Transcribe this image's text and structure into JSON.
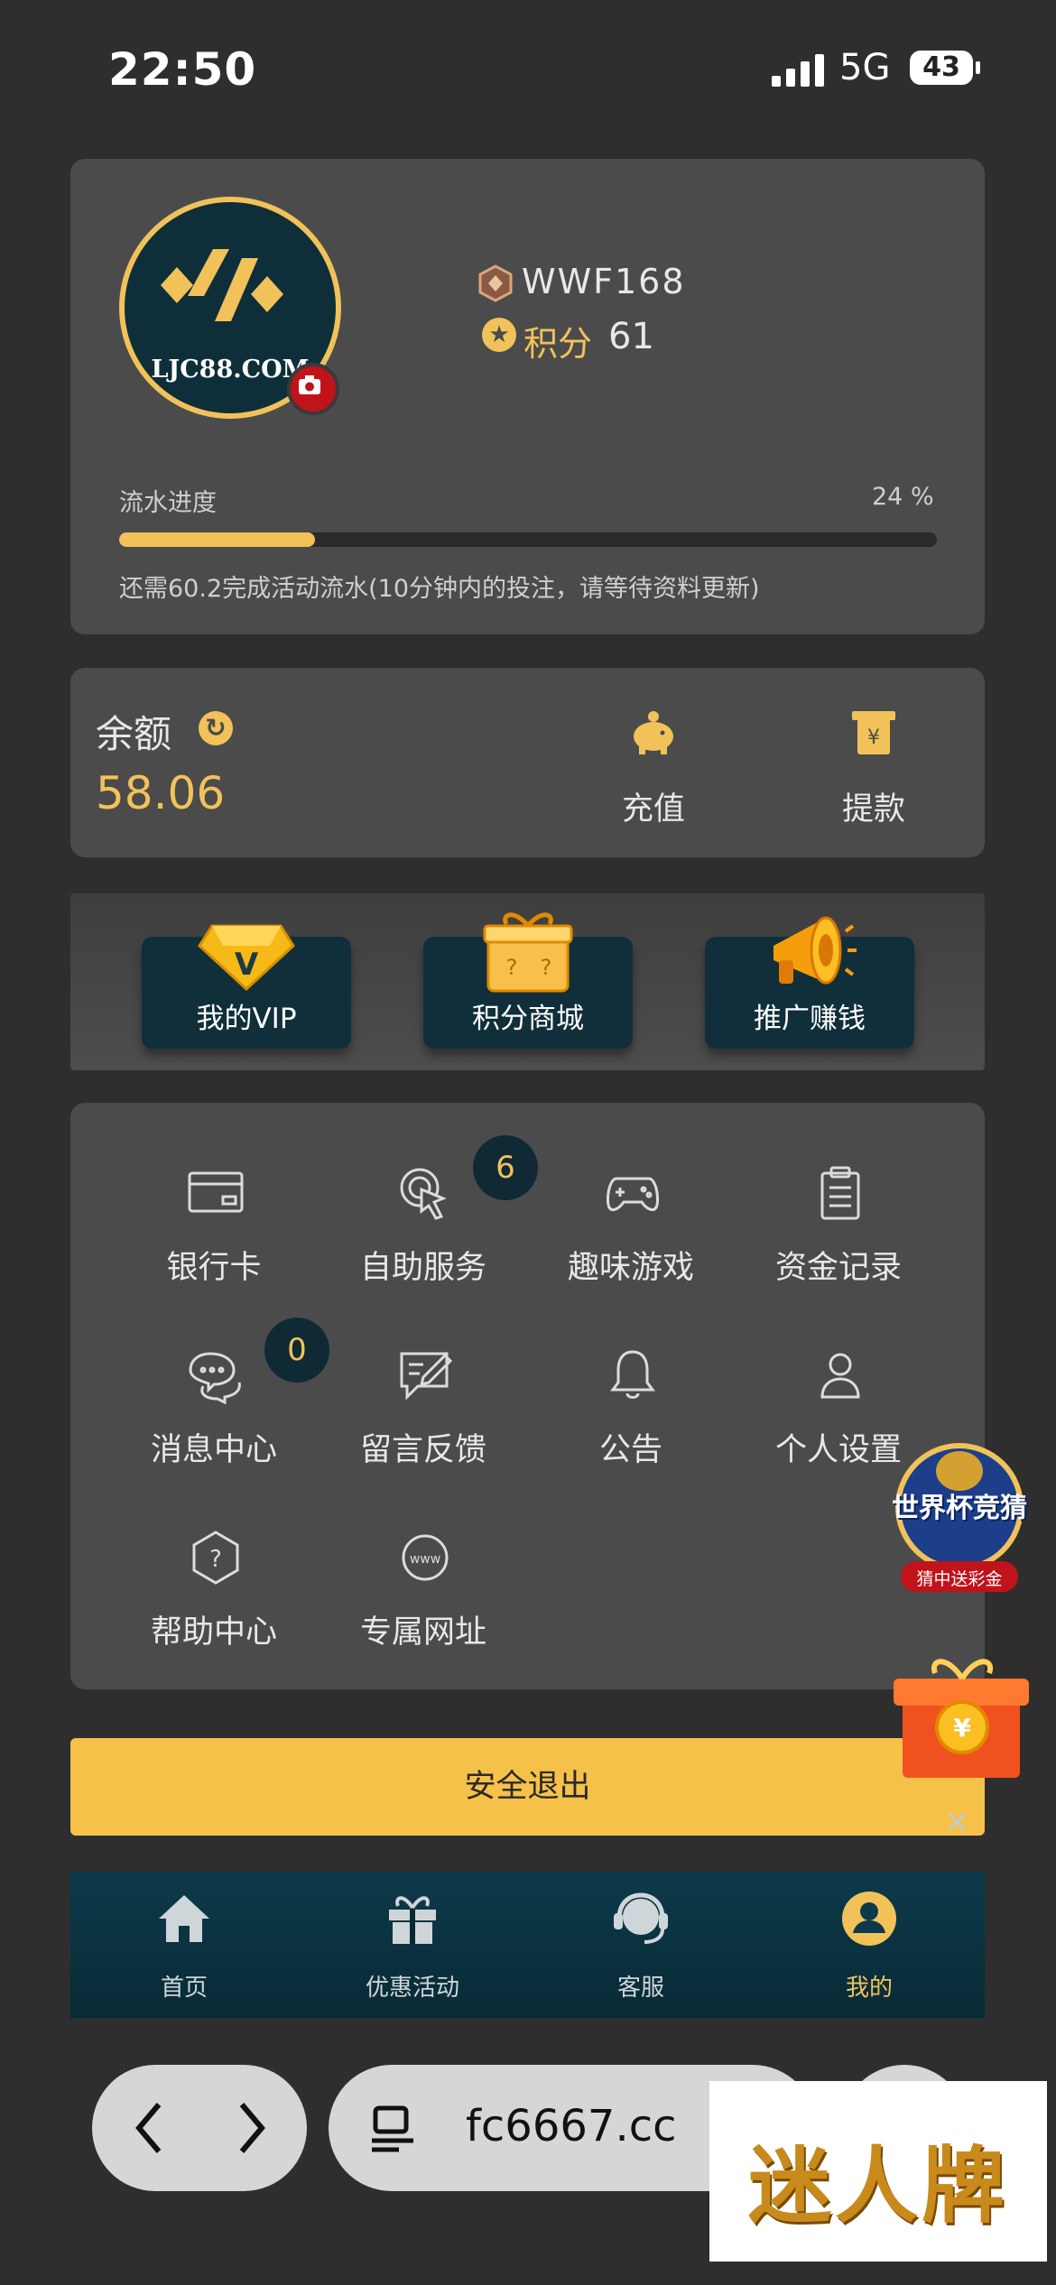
{
  "status_bar": {
    "time": "22:50",
    "network": "5G",
    "battery": "43"
  },
  "profile": {
    "avatar_brand": "LJC88.COM",
    "username": "WWF168",
    "points_label": "积分",
    "points_value": "61",
    "progress_label": "流水进度",
    "progress_percent_text": "24 %",
    "progress_fraction": 0.24,
    "progress_note": "还需60.2完成活动流水(10分钟内的投注，请等待资料更新)"
  },
  "balance": {
    "label": "余额",
    "value": "58.06",
    "actions": [
      {
        "label": "充值",
        "icon": "piggy-bank-icon"
      },
      {
        "label": "提款",
        "icon": "withdraw-icon"
      }
    ]
  },
  "quick_actions": [
    {
      "label": "我的VIP",
      "icon": "vip-diamond-icon"
    },
    {
      "label": "积分商城",
      "icon": "gift-box-icon"
    },
    {
      "label": "推广赚钱",
      "icon": "megaphone-icon"
    }
  ],
  "menu": [
    {
      "label": "银行卡",
      "icon": "bank-card-icon"
    },
    {
      "label": "自助服务",
      "icon": "touch-icon",
      "badge": "6"
    },
    {
      "label": "趣味游戏",
      "icon": "gamepad-icon"
    },
    {
      "label": "资金记录",
      "icon": "clipboard-icon"
    },
    {
      "label": "消息中心",
      "icon": "chat-icon",
      "badge": "0"
    },
    {
      "label": "留言反馈",
      "icon": "feedback-icon"
    },
    {
      "label": "公告",
      "icon": "bell-icon"
    },
    {
      "label": "个人设置",
      "icon": "user-icon"
    },
    {
      "label": "帮助中心",
      "icon": "help-icon"
    },
    {
      "label": "专属网址",
      "icon": "www-icon"
    }
  ],
  "logout_label": "安全退出",
  "floating": {
    "worldcup_title": "世界杯竞猜",
    "worldcup_sub": "猜中送彩金"
  },
  "tabs": [
    {
      "label": "首页",
      "icon": "home-icon"
    },
    {
      "label": "优惠活动",
      "icon": "gift-icon"
    },
    {
      "label": "客服",
      "icon": "headset-icon"
    },
    {
      "label": "我的",
      "icon": "profile-icon",
      "active": true
    }
  ],
  "browser": {
    "url": "fc6667.cc"
  },
  "watermark": "迷人牌",
  "colors": {
    "accent": "#f2c25a",
    "card": "#4b4b4b",
    "background": "#2e2e2e",
    "teal": "#0f2f3b"
  }
}
